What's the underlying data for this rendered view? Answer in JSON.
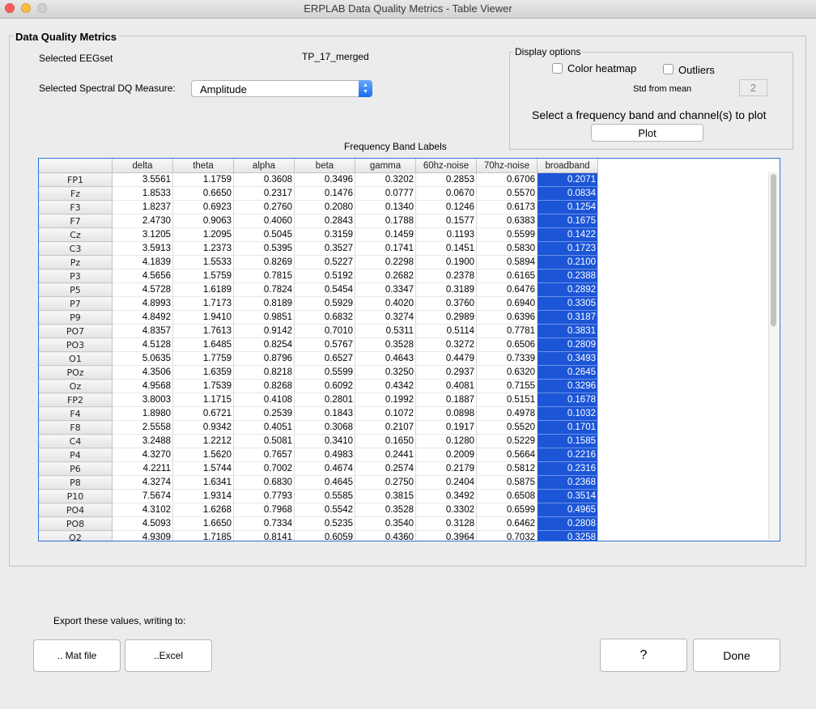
{
  "window": {
    "title": "ERPLAB Data Quality Metrics - Table Viewer"
  },
  "panel": {
    "title": "Data Quality Metrics"
  },
  "eegset": {
    "label": "Selected EEGset",
    "value": "TP_17_merged"
  },
  "measure": {
    "label": "Selected Spectral DQ Measure:",
    "selected": "Amplitude"
  },
  "display_options": {
    "title": "Display options",
    "color_heatmap_label": "Color heatmap",
    "color_heatmap_checked": false,
    "outliers_label": "Outliers",
    "outliers_checked": false,
    "std_label": "Std from mean",
    "std_value": "2",
    "plot_prompt": "Select a frequency band and channel(s) to plot",
    "plot_button": "Plot"
  },
  "table": {
    "caption": "Frequency Band Labels",
    "columns": [
      "delta",
      "theta",
      "alpha",
      "beta",
      "gamma",
      "60hz-noise",
      "70hz-noise",
      "broadband"
    ],
    "selected_column": "broadband",
    "rows": [
      {
        "channel": "FP1",
        "values": [
          "3.5561",
          "1.1759",
          "0.3608",
          "0.3496",
          "0.3202",
          "0.2853",
          "0.6706",
          "0.2071"
        ]
      },
      {
        "channel": "Fz",
        "values": [
          "1.8533",
          "0.6650",
          "0.2317",
          "0.1476",
          "0.0777",
          "0.0670",
          "0.5570",
          "0.0834"
        ]
      },
      {
        "channel": "F3",
        "values": [
          "1.8237",
          "0.6923",
          "0.2760",
          "0.2080",
          "0.1340",
          "0.1246",
          "0.6173",
          "0.1254"
        ]
      },
      {
        "channel": "F7",
        "values": [
          "2.4730",
          "0.9063",
          "0.4060",
          "0.2843",
          "0.1788",
          "0.1577",
          "0.6383",
          "0.1675"
        ]
      },
      {
        "channel": "Cz",
        "values": [
          "3.1205",
          "1.2095",
          "0.5045",
          "0.3159",
          "0.1459",
          "0.1193",
          "0.5599",
          "0.1422"
        ]
      },
      {
        "channel": "C3",
        "values": [
          "3.5913",
          "1.2373",
          "0.5395",
          "0.3527",
          "0.1741",
          "0.1451",
          "0.5830",
          "0.1723"
        ]
      },
      {
        "channel": "Pz",
        "values": [
          "4.1839",
          "1.5533",
          "0.8269",
          "0.5227",
          "0.2298",
          "0.1900",
          "0.5894",
          "0.2100"
        ]
      },
      {
        "channel": "P3",
        "values": [
          "4.5656",
          "1.5759",
          "0.7815",
          "0.5192",
          "0.2682",
          "0.2378",
          "0.6165",
          "0.2388"
        ]
      },
      {
        "channel": "P5",
        "values": [
          "4.5728",
          "1.6189",
          "0.7824",
          "0.5454",
          "0.3347",
          "0.3189",
          "0.6476",
          "0.2892"
        ]
      },
      {
        "channel": "P7",
        "values": [
          "4.8993",
          "1.7173",
          "0.8189",
          "0.5929",
          "0.4020",
          "0.3760",
          "0.6940",
          "0.3305"
        ]
      },
      {
        "channel": "P9",
        "values": [
          "4.8492",
          "1.9410",
          "0.9851",
          "0.6832",
          "0.3274",
          "0.2989",
          "0.6396",
          "0.3187"
        ]
      },
      {
        "channel": "PO7",
        "values": [
          "4.8357",
          "1.7613",
          "0.9142",
          "0.7010",
          "0.5311",
          "0.5114",
          "0.7781",
          "0.3831"
        ]
      },
      {
        "channel": "PO3",
        "values": [
          "4.5128",
          "1.6485",
          "0.8254",
          "0.5767",
          "0.3528",
          "0.3272",
          "0.6506",
          "0.2809"
        ]
      },
      {
        "channel": "O1",
        "values": [
          "5.0635",
          "1.7759",
          "0.8796",
          "0.6527",
          "0.4643",
          "0.4479",
          "0.7339",
          "0.3493"
        ]
      },
      {
        "channel": "POz",
        "values": [
          "4.3506",
          "1.6359",
          "0.8218",
          "0.5599",
          "0.3250",
          "0.2937",
          "0.6320",
          "0.2645"
        ]
      },
      {
        "channel": "Oz",
        "values": [
          "4.9568",
          "1.7539",
          "0.8268",
          "0.6092",
          "0.4342",
          "0.4081",
          "0.7155",
          "0.3296"
        ]
      },
      {
        "channel": "FP2",
        "values": [
          "3.8003",
          "1.1715",
          "0.4108",
          "0.2801",
          "0.1992",
          "0.1887",
          "0.5151",
          "0.1678"
        ]
      },
      {
        "channel": "F4",
        "values": [
          "1.8980",
          "0.6721",
          "0.2539",
          "0.1843",
          "0.1072",
          "0.0898",
          "0.4978",
          "0.1032"
        ]
      },
      {
        "channel": "F8",
        "values": [
          "2.5558",
          "0.9342",
          "0.4051",
          "0.3068",
          "0.2107",
          "0.1917",
          "0.5520",
          "0.1701"
        ]
      },
      {
        "channel": "C4",
        "values": [
          "3.2488",
          "1.2212",
          "0.5081",
          "0.3410",
          "0.1650",
          "0.1280",
          "0.5229",
          "0.1585"
        ]
      },
      {
        "channel": "P4",
        "values": [
          "4.3270",
          "1.5620",
          "0.7657",
          "0.4983",
          "0.2441",
          "0.2009",
          "0.5664",
          "0.2216"
        ]
      },
      {
        "channel": "P6",
        "values": [
          "4.2211",
          "1.5744",
          "0.7002",
          "0.4674",
          "0.2574",
          "0.2179",
          "0.5812",
          "0.2316"
        ]
      },
      {
        "channel": "P8",
        "values": [
          "4.3274",
          "1.6341",
          "0.6830",
          "0.4645",
          "0.2750",
          "0.2404",
          "0.5875",
          "0.2368"
        ]
      },
      {
        "channel": "P10",
        "values": [
          "7.5674",
          "1.9314",
          "0.7793",
          "0.5585",
          "0.3815",
          "0.3492",
          "0.6508",
          "0.3514"
        ]
      },
      {
        "channel": "PO4",
        "values": [
          "4.3102",
          "1.6268",
          "0.7968",
          "0.5542",
          "0.3528",
          "0.3302",
          "0.6599",
          "0.4965"
        ]
      },
      {
        "channel": "PO8",
        "values": [
          "4.5093",
          "1.6650",
          "0.7334",
          "0.5235",
          "0.3540",
          "0.3128",
          "0.6462",
          "0.2808"
        ]
      },
      {
        "channel": "O2",
        "values": [
          "4.9309",
          "1.7185",
          "0.8141",
          "0.6059",
          "0.4360",
          "0.3964",
          "0.7032",
          "0.3258"
        ]
      }
    ]
  },
  "export": {
    "label": "Export these values, writing to:",
    "mat_button": ".. Mat file",
    "excel_button": "..Excel"
  },
  "help_button": "?",
  "done_button": "Done",
  "colors": {
    "selection": "#1c55d6",
    "table_border": "#2e74d8",
    "popup_arrow": "#1b6cf1"
  }
}
